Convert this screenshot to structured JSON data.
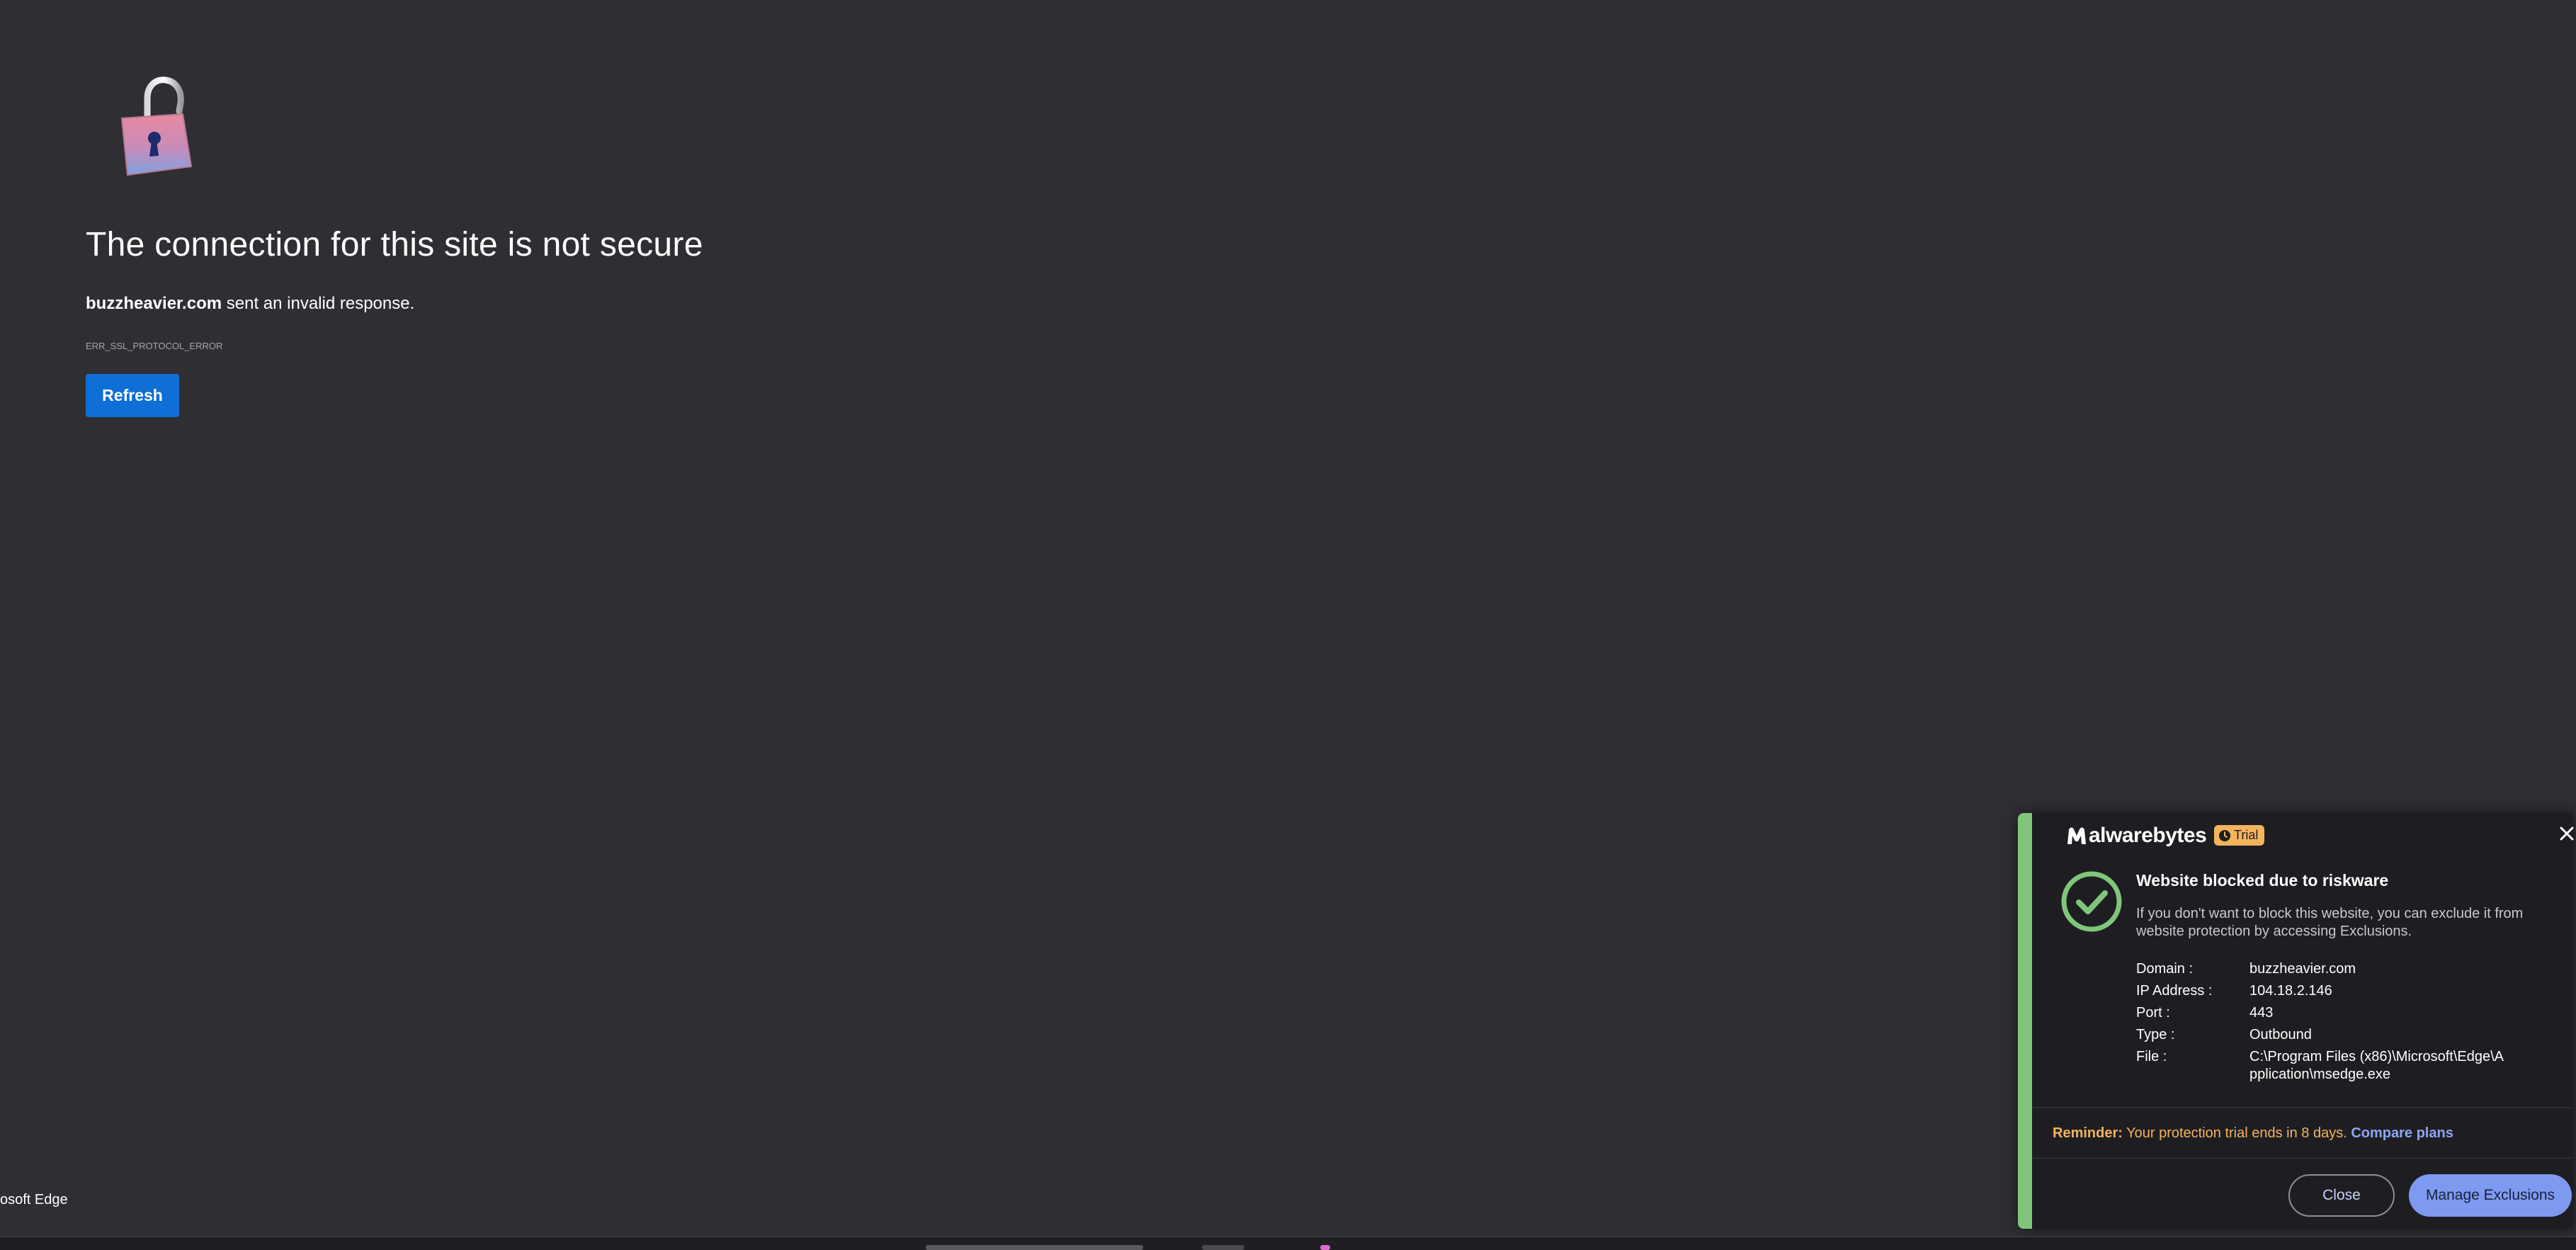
{
  "error_page": {
    "title": "The connection for this site is not secure",
    "domain": "buzzheavier.com",
    "description_suffix": " sent an invalid response.",
    "error_code": "ERR_SSL_PROTOCOL_ERROR",
    "refresh_label": "Refresh"
  },
  "taskbar": {
    "app_label": "osoft Edge"
  },
  "popup": {
    "brand": "alwarebytes",
    "trial_label": "Trial",
    "title": "Website blocked due to riskware",
    "message": "If you don't want to block this website, you can exclude it from website protection by accessing Exclusions.",
    "details": [
      {
        "key": "Domain :",
        "value": "buzzheavier.com"
      },
      {
        "key": "IP Address :",
        "value": "104.18.2.146"
      },
      {
        "key": "Port :",
        "value": "443"
      },
      {
        "key": "Type :",
        "value": "Outbound"
      },
      {
        "key": "File :",
        "value": "C:\\Program Files (x86)\\Microsoft\\Edge\\Application\\msedge.exe"
      }
    ],
    "reminder_label": "Reminder:",
    "reminder_text": " Your protection trial ends in 8 days. ",
    "compare_label": "Compare plans",
    "close_label": "Close",
    "manage_label": "Manage Exclusions"
  },
  "colors": {
    "page_background": "#2f2e33",
    "refresh_button": "#0f6fd6",
    "popup_accent": "#7fc67a",
    "trial_badge": "#f3b45c",
    "manage_button": "#7e9af0"
  },
  "icons": {
    "lock": "unlocked-padlock-icon",
    "check": "check-circle-icon",
    "close": "close-icon",
    "clock": "clock-icon"
  }
}
